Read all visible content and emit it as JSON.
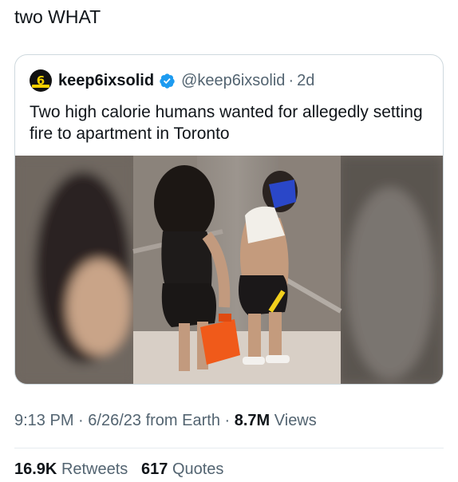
{
  "tweet": {
    "text": "two WHAT"
  },
  "quoted": {
    "display_name": "keep6ixsolid",
    "handle": "@keep6ixsolid",
    "separator": "·",
    "age": "2d",
    "text": "Two high calorie humans wanted for allegedly setting fire to apartment in Toronto",
    "avatar_glyph": "6",
    "verified_color": "#1d9bf0"
  },
  "meta": {
    "time": "9:13 PM",
    "dot": "·",
    "date": "6/26/23",
    "source": "from Earth",
    "views_count": "8.7M",
    "views_label": "Views"
  },
  "stats": {
    "retweets_count": "16.9K",
    "retweets_label": "Retweets",
    "quotes_count": "617",
    "quotes_label": "Quotes"
  },
  "media": {
    "description_icon": "photo"
  }
}
